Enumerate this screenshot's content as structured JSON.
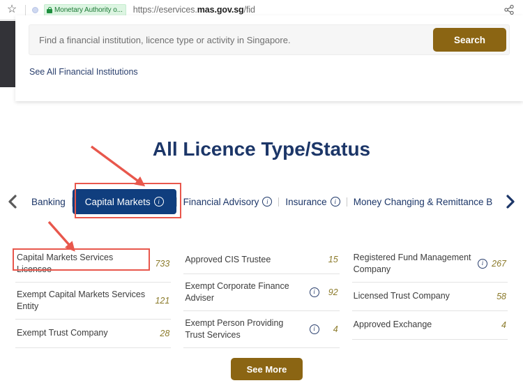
{
  "browser": {
    "star_icon": "bookmark-star-icon",
    "site_dot_icon": "site-identity-icon",
    "ev_badge": {
      "lock_icon": "lock-icon",
      "text": "Monetary Authority o..."
    },
    "url": {
      "scheme": "https://eservices.",
      "host": "mas.gov.sg",
      "path": "/fid"
    },
    "share_icon": "share-icon"
  },
  "search": {
    "placeholder": "Find a financial institution, licence type or activity in Singapore.",
    "value": "",
    "button_label": "Search",
    "see_all_label": "See All Financial Institutions"
  },
  "page": {
    "title": "All Licence Type/Status",
    "see_more_label": "See More"
  },
  "tabs": {
    "prev_icon": "chevron-left-icon",
    "next_icon": "chevron-right-icon",
    "items": [
      {
        "label": "Banking",
        "has_info": false,
        "active": false
      },
      {
        "label": "Capital Markets",
        "has_info": true,
        "active": true
      },
      {
        "label": "Financial Advisory",
        "has_info": true,
        "active": false
      },
      {
        "label": "Insurance",
        "has_info": true,
        "active": false
      },
      {
        "label": "Money Changing & Remittance B",
        "has_info": false,
        "active": false
      }
    ]
  },
  "licences": {
    "columns": [
      [
        {
          "label": "Capital Markets Services Licensee",
          "count": "733",
          "has_info": false
        },
        {
          "label": "Exempt Capital Markets Services Entity",
          "count": "121",
          "has_info": false
        },
        {
          "label": "Exempt Trust Company",
          "count": "28",
          "has_info": false
        }
      ],
      [
        {
          "label": "Approved CIS Trustee",
          "count": "15",
          "has_info": false
        },
        {
          "label": "Exempt Corporate Finance Adviser",
          "count": "92",
          "has_info": true
        },
        {
          "label": "Exempt Person Providing Trust Services",
          "count": "4",
          "has_info": true
        }
      ],
      [
        {
          "label": "Registered Fund Management Company",
          "count": "267",
          "has_info": true
        },
        {
          "label": "Licensed Trust Company",
          "count": "58",
          "has_info": false
        },
        {
          "label": "Approved Exchange",
          "count": "4",
          "has_info": false
        }
      ]
    ]
  },
  "annotations": {
    "highlight_color": "#e8574c",
    "boxes": [
      {
        "name": "capital-markets-tab-highlight"
      },
      {
        "name": "capital-markets-services-licensee-highlight"
      }
    ],
    "arrows": [
      {
        "name": "arrow-to-capital-markets-tab"
      },
      {
        "name": "arrow-to-capital-markets-services-licensee"
      }
    ]
  },
  "colors": {
    "brand_navy": "#103e7e",
    "title_navy": "#1c3668",
    "gold": "#8b6513",
    "count_gold": "#8b7a2a",
    "annotation_red": "#e8574c"
  }
}
